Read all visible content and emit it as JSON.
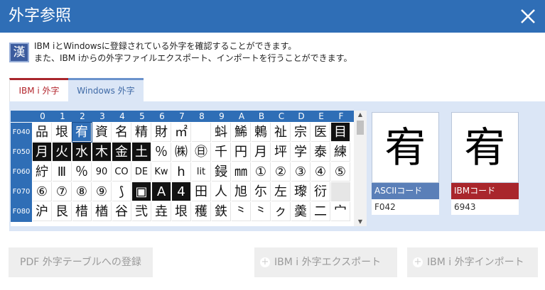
{
  "dialog": {
    "title": "外字参照",
    "description_line1": "IBM iとWindowsに登録されている外字を確認することができます。",
    "description_line2": "また、IBM iからの外字ファイルエクスポート、インポートを行うことができます。",
    "info_icon_char": "漢"
  },
  "tabs": [
    {
      "label": "IBM i 外字",
      "active": false
    },
    {
      "label": "Windows 外字",
      "active": true
    }
  ],
  "grid": {
    "columns": [
      "0",
      "1",
      "2",
      "3",
      "4",
      "5",
      "6",
      "7",
      "8",
      "9",
      "A",
      "B",
      "C",
      "D",
      "E",
      "F"
    ],
    "rows": [
      {
        "label": "F040",
        "cells": [
          "品",
          "垠",
          "宥",
          "資",
          "名",
          "精",
          "財",
          "㎡",
          "",
          "蚪",
          "鯑",
          "鶇",
          "祉",
          "宗",
          "医",
          "目"
        ]
      },
      {
        "label": "F050",
        "cells": [
          "月",
          "火",
          "水",
          "木",
          "金",
          "土",
          "％",
          "㈱",
          "㊐",
          "千",
          "円",
          "月",
          "坪",
          "学",
          "泰",
          "練"
        ]
      },
      {
        "label": "F060",
        "cells": [
          "紵",
          "Ⅲ",
          "％",
          "90",
          "CO",
          "DE",
          "Kw",
          "h",
          "lit",
          "鋟",
          "㎜",
          "①",
          "②",
          "③",
          "④",
          "⑤"
        ]
      },
      {
        "label": "F070",
        "cells": [
          "⑥",
          "⑦",
          "⑧",
          "⑨",
          "⟆",
          "▣",
          "A",
          "4",
          "田",
          "人",
          "旭",
          "尓",
          "左",
          "瓈",
          "衍",
          ""
        ]
      },
      {
        "label": "F080",
        "cells": [
          "沪",
          "艮",
          "棤",
          "楢",
          "谷",
          "弐",
          "垚",
          "垠",
          "穫",
          "鉄",
          "⺀",
          "⺀",
          "ㇰ",
          "羮",
          "二",
          "宀"
        ]
      }
    ],
    "inverted_cells": [
      "F04F",
      "F050",
      "F051",
      "F052",
      "F053",
      "F054",
      "F055",
      "F075",
      "F076",
      "F077"
    ],
    "selected_cell": "F042",
    "empty_cells": [
      "F07F"
    ]
  },
  "preview": {
    "ascii_label": "ASCIIコード",
    "ascii_value": "F042",
    "ibm_label": "IBMコード",
    "ibm_value": "6943",
    "glyph": "宥"
  },
  "buttons": {
    "pdf": "PDF 外字テーブルへの登録",
    "export": "IBM i 外字エクスポート",
    "import": "IBM i 外字インポート"
  },
  "colors": {
    "title_bar": "#2f6eb6",
    "ascii_label_bg": "#5a7fb8",
    "ibm_label_bg": "#a9262c",
    "panel_bg": "#dbe6f6"
  }
}
